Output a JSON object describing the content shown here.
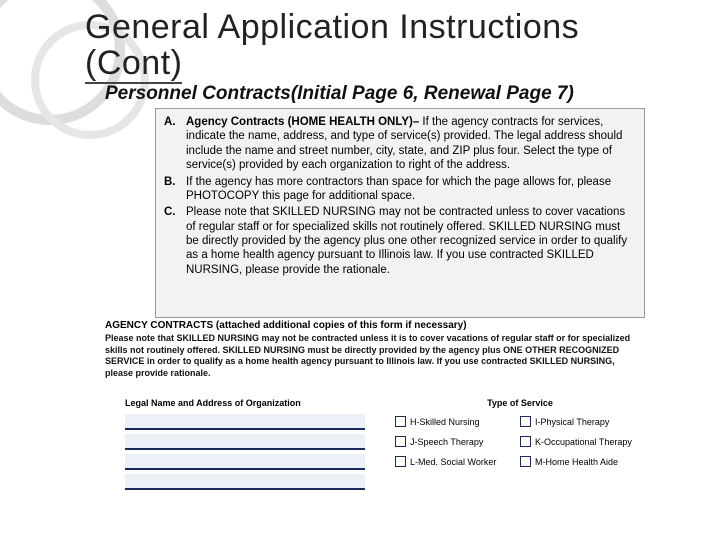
{
  "title_line1": "General Application Instructions",
  "title_line2": "(Cont)",
  "subtitle": "Personnel Contracts(Initial Page 6, Renewal Page 7)",
  "instructions": [
    {
      "marker": "A.",
      "lead": "Agency Contracts (HOME HEALTH ONLY)–",
      "body": " If the agency contracts for services, indicate the name, address, and type of service(s) provided.  The legal address should include the name and street number, city, state, and ZIP plus four.  Select the type of service(s) provided by each organization to right of the address."
    },
    {
      "marker": "B.",
      "lead": "",
      "body": "If the agency has more contractors than space for which the page allows for, please PHOTOCOPY  this page for additional space."
    },
    {
      "marker": "C.",
      "lead": "",
      "body": "Please note that SKILLED NURSING may not be contracted unless to cover vacations of regular staff or for specialized skills not routinely offered. SKILLED NURSING must be directly provided by the agency plus one other recognized service in order to qualify as a home health agency pursuant to Illinois law.  If you use contracted SKILLED NURSING, please provide the rationale."
    }
  ],
  "form": {
    "header": "AGENCY CONTRACTS (attached additional copies of this form if necessary)",
    "note": "Please note that SKILLED NURSING may not be contracted unless it is to cover vacations of regular staff or for specialized skills not routinely offered.  SKILLED NURSING must be directly provided by the agency plus ONE OTHER RECOGNIZED SERVICE in order to qualify as a home health agency pursuant to Illinois law.  If you use contracted SKILLED NURSING, please provide rationale.",
    "label_left": "Legal Name and Address of Organization",
    "label_right": "Type of Service",
    "service_types": [
      {
        "code": "H",
        "label": "H-Skilled Nursing"
      },
      {
        "code": "I",
        "label": "I-Physical Therapy"
      },
      {
        "code": "J",
        "label": "J-Speech Therapy"
      },
      {
        "code": "K",
        "label": "K-Occupational Therapy"
      },
      {
        "code": "L",
        "label": "L-Med. Social Worker"
      },
      {
        "code": "M",
        "label": "M-Home Health Aide"
      }
    ]
  }
}
